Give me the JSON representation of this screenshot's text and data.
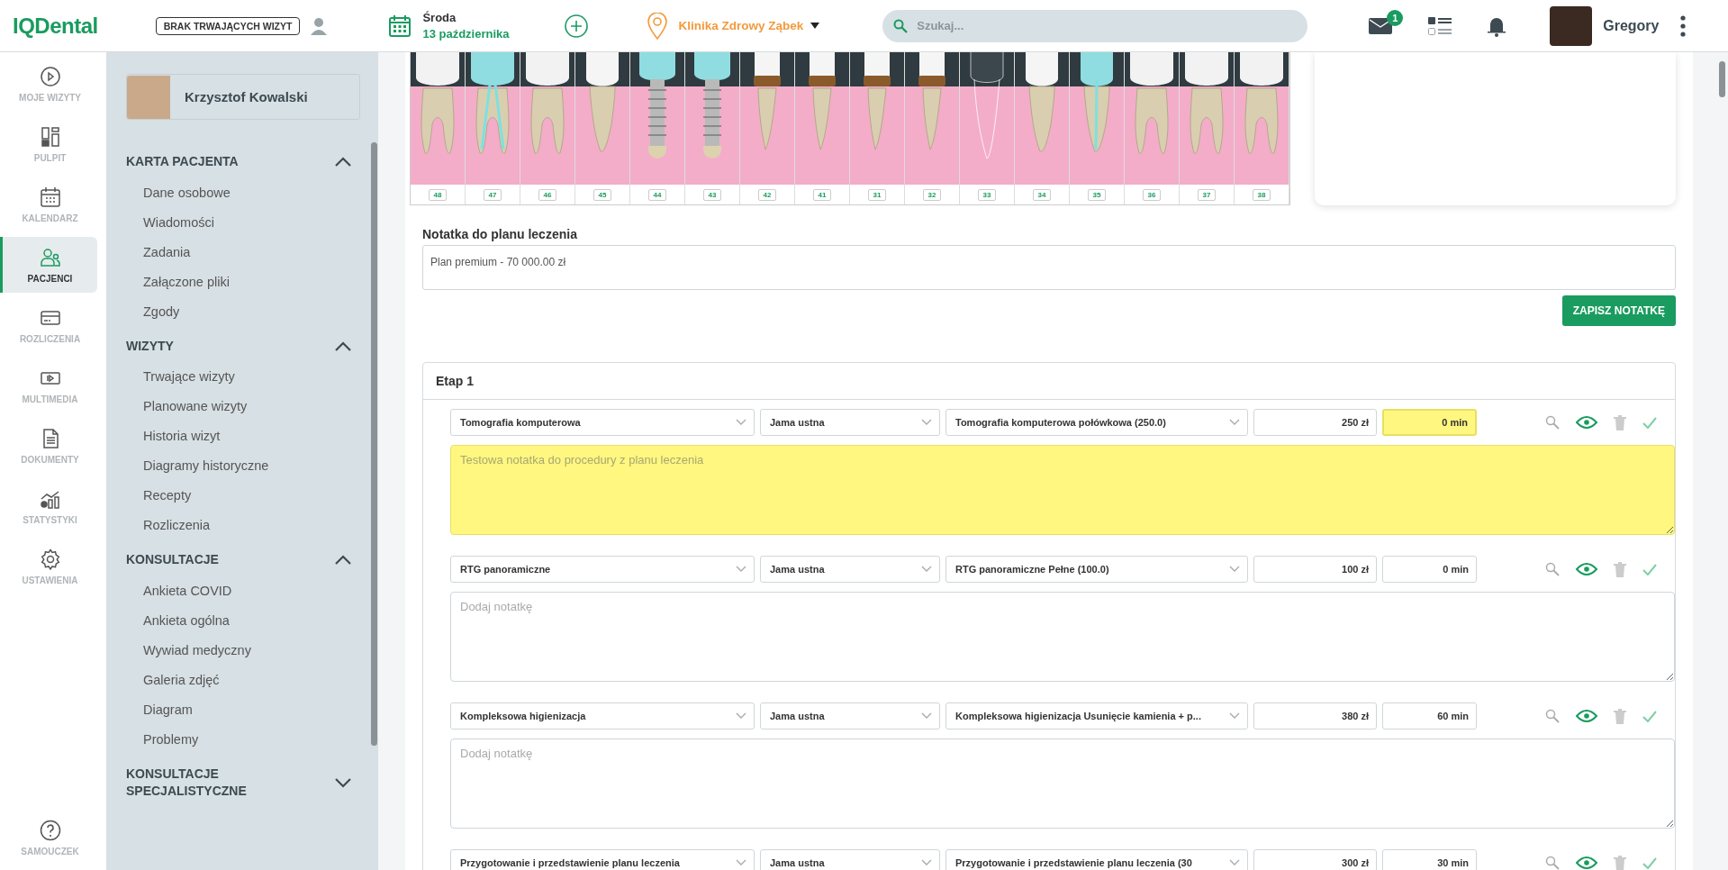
{
  "topbar": {
    "logo": "IQDental",
    "visit_status": "BRAK TRWAJĄCYCH WIZYT",
    "day": "Środa",
    "date": "13 października",
    "clinic": "Klinika Zdrowy Ząbek",
    "search": {
      "placeholder": "Szukaj..."
    },
    "mail_count": "1",
    "user": "Gregory"
  },
  "rail": {
    "items": [
      {
        "label": "MOJE WIZYTY",
        "selected": false
      },
      {
        "label": "PULPIT",
        "selected": false
      },
      {
        "label": "KALENDARZ",
        "selected": false
      },
      {
        "label": "PACJENCI",
        "selected": true
      },
      {
        "label": "ROZLICZENIA",
        "selected": false
      },
      {
        "label": "MULTIMEDIA",
        "selected": false
      },
      {
        "label": "DOKUMENTY",
        "selected": false
      },
      {
        "label": "STATYSTYKI",
        "selected": false
      },
      {
        "label": "USTAWIENIA",
        "selected": false
      }
    ],
    "footer": "SAMOUCZEK"
  },
  "patient": {
    "name": "Krzysztof Kowalski"
  },
  "menu": [
    {
      "title": "KARTA PACJENTA",
      "expanded": true,
      "items": [
        "Dane osobowe",
        "Wiadomości",
        "Zadania",
        "Załączone pliki",
        "Zgody"
      ]
    },
    {
      "title": "WIZYTY",
      "expanded": true,
      "items": [
        "Trwające wizyty",
        "Planowane wizyty",
        "Historia wizyt",
        "Diagramy historyczne",
        "Recepty",
        "Rozliczenia"
      ]
    },
    {
      "title": "KONSULTACJE",
      "expanded": true,
      "items": [
        "Ankieta COVID",
        "Ankieta ogólna",
        "Wywiad medyczny",
        "Galeria zdjęć",
        "Diagram",
        "Problemy"
      ]
    },
    {
      "title": "KONSULTACJE SPECJALISTYCZNE",
      "expanded": false
    }
  ],
  "teeth": [
    {
      "number": "48",
      "kind": "molar"
    },
    {
      "number": "47",
      "kind": "root-canal-molar"
    },
    {
      "number": "46",
      "kind": "molar"
    },
    {
      "number": "45",
      "kind": "premolar"
    },
    {
      "number": "44",
      "kind": "implant"
    },
    {
      "number": "43",
      "kind": "implant"
    },
    {
      "number": "42",
      "kind": "banded"
    },
    {
      "number": "41",
      "kind": "banded"
    },
    {
      "number": "31",
      "kind": "banded"
    },
    {
      "number": "32",
      "kind": "banded"
    },
    {
      "number": "33",
      "kind": "outline"
    },
    {
      "number": "34",
      "kind": "premolar"
    },
    {
      "number": "35",
      "kind": "root-canal-premolar"
    },
    {
      "number": "36",
      "kind": "molar"
    },
    {
      "number": "37",
      "kind": "molar"
    },
    {
      "number": "38",
      "kind": "molar"
    }
  ],
  "plan_note": {
    "label": "Notatka do planu leczenia",
    "value": "Plan premium - 70 000.00 zł",
    "button": "ZAPISZ NOTATKĘ"
  },
  "stage": {
    "title": "Etap 1",
    "procedures": [
      {
        "procedure": "Tomografia komputerowa",
        "area": "Jama ustna",
        "variant": "Tomografia komputerowa połówkowa (250.0)",
        "price": "250 zł",
        "time": "0 min",
        "highlighted": true,
        "note": "Testowa notatka do procedury z planu leczenia"
      },
      {
        "procedure": "RTG panoramiczne",
        "area": "Jama ustna",
        "variant": "RTG panoramiczne Pełne (100.0)",
        "price": "100 zł",
        "time": "0 min",
        "highlighted": false,
        "placeholder": "Dodaj notatkę"
      },
      {
        "procedure": "Kompleksowa higienizacja",
        "area": "Jama ustna",
        "variant": "Kompleksowa higienizacja Usunięcie kamienia + p...",
        "price": "380 zł",
        "time": "60 min",
        "highlighted": false,
        "placeholder": "Dodaj notatkę"
      },
      {
        "procedure": "Przygotowanie i przedstawienie planu leczenia",
        "area": "Jama ustna",
        "variant": "Przygotowanie i przedstawienie planu leczenia (30",
        "price": "300 zł",
        "time": "30 min",
        "highlighted": false
      }
    ]
  }
}
